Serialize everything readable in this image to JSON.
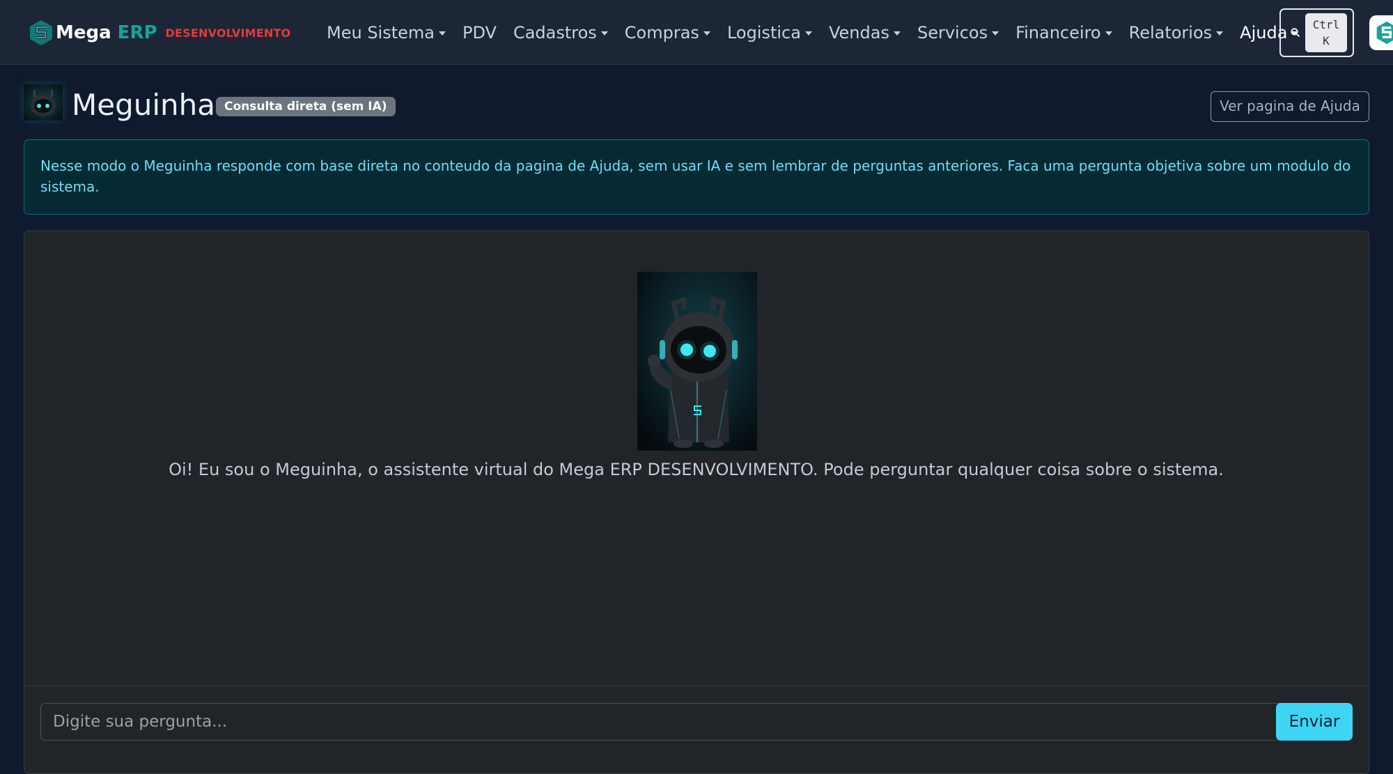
{
  "brand": {
    "name_primary": "Mega",
    "name_secondary": "ERP",
    "environment": "DESENVOLVIMENTO"
  },
  "nav": {
    "items": [
      {
        "label": "Meu Sistema",
        "dropdown": true
      },
      {
        "label": "PDV",
        "dropdown": false
      },
      {
        "label": "Cadastros",
        "dropdown": true
      },
      {
        "label": "Compras",
        "dropdown": true
      },
      {
        "label": "Logistica",
        "dropdown": true
      },
      {
        "label": "Vendas",
        "dropdown": true
      },
      {
        "label": "Servicos",
        "dropdown": true
      },
      {
        "label": "Financeiro",
        "dropdown": true
      },
      {
        "label": "Relatorios",
        "dropdown": true
      },
      {
        "label": "Ajuda",
        "dropdown": true,
        "active": true
      }
    ],
    "search_shortcut": {
      "key1": "Ctrl",
      "key2": "K"
    }
  },
  "header": {
    "title": "Meguinha",
    "mode_badge": "Consulta direta (sem IA)",
    "help_button": "Ver pagina de Ajuda"
  },
  "alert": {
    "text": "Nesse modo o Meguinha responde com base direta no conteudo da pagina de Ajuda, sem usar IA e sem lembrar de perguntas anteriores. Faca uma pergunta objetiva sobre um modulo do sistema."
  },
  "chat": {
    "welcome_message": "Oi! Eu sou o Meguinha, o assistente virtual do Mega ERP DESENVOLVIMENTO. Pode perguntar qualquer coisa sobre o sistema.",
    "input_placeholder": "Digite sua pergunta...",
    "input_value": "",
    "send_label": "Enviar"
  },
  "colors": {
    "navbar_bg": "#1c2637",
    "page_bg": "#0f1a2e",
    "brand_accent": "#16a39a",
    "environment_red": "#e23b3b",
    "alert_text": "#6edff6",
    "send_button": "#3dd5f3",
    "robot_glow": "#3ee8f0"
  }
}
